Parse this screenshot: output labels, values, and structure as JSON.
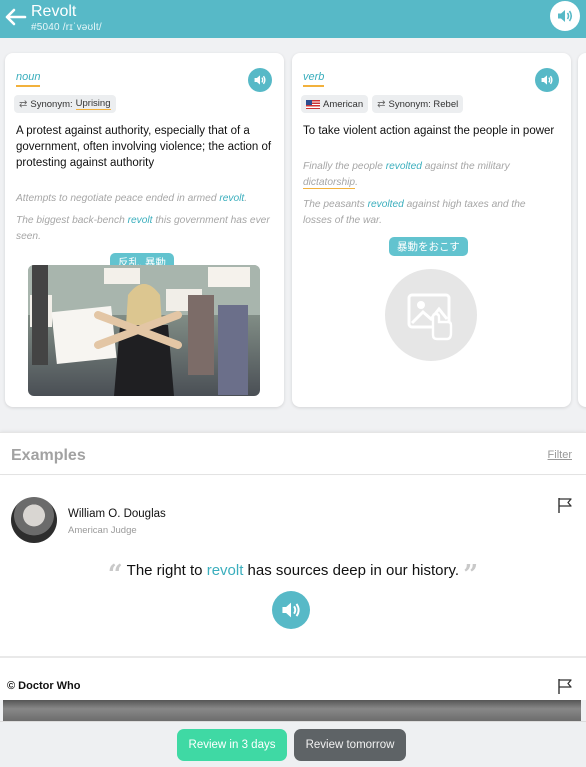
{
  "header": {
    "title": "Revolt",
    "subtitle": "#5040 /rɪˈvəʊlt/"
  },
  "cards": [
    {
      "pos": "noun",
      "chips": [
        {
          "label": "Synonym: ",
          "word": "Uprising"
        }
      ],
      "definition": "A protest against authority, especially that of a government, often involving violence; the action of protesting against authority",
      "examples": [
        {
          "before": "Attempts to negotiate peace ended in armed ",
          "hl": "revolt",
          "after": "."
        },
        {
          "before": "The biggest back-bench ",
          "hl": "revolt",
          "after": " this government has ever seen."
        }
      ],
      "translation": "反乱, 暴動"
    },
    {
      "pos": "verb",
      "chips": [
        {
          "label": "American"
        },
        {
          "label": "Synonym: Rebel"
        }
      ],
      "definition": "To take violent action against the people in power",
      "examples": [
        {
          "before": "Finally the people ",
          "hl": "revolted",
          "after": " against the military ",
          "und": "dictatorship",
          "end": "."
        },
        {
          "before": "The peasants ",
          "hl": "revolted",
          "after": " against high taxes and the losses of the war."
        }
      ],
      "translation": "暴動をおこす"
    }
  ],
  "examples": {
    "title": "Examples",
    "filter": "Filter",
    "person": {
      "name": "William O. Douglas",
      "role": "American Judge"
    },
    "quote": {
      "before": "The right to ",
      "hl": "revolt",
      "after": " has sources deep in our history."
    },
    "source": "© Doctor Who"
  },
  "bottom": {
    "review_3_days": "Review in 3 days",
    "review_tomorrow": "Review tomorrow"
  },
  "colors": {
    "accent": "#57b9c7",
    "link": "#3aaebd",
    "underline": "#f2b13c",
    "green": "#3fd9a4"
  }
}
